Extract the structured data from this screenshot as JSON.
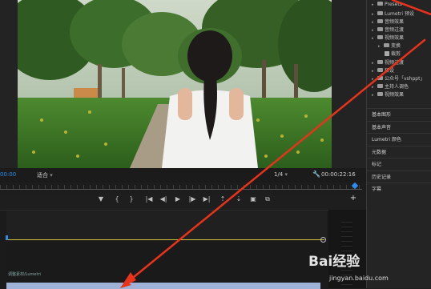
{
  "monitor": {
    "timecode_left": "00:00",
    "fit": "适合",
    "resolution": "1/4",
    "timecode_right": "00:00:22:16"
  },
  "transport": {
    "icons": [
      "marker-icon",
      "in-point-icon",
      "out-point-icon",
      "go-to-in-icon",
      "step-back-icon",
      "play-icon",
      "step-forward-icon",
      "go-to-out-icon",
      "lift-icon",
      "extract-icon",
      "export-frame-icon",
      "compare-icon"
    ],
    "glyphs": [
      "▼",
      "{",
      "}",
      "|◀",
      "◀|",
      "▶",
      "|▶",
      "▶|",
      "⇡",
      "⇣",
      "▣",
      "⧉"
    ],
    "add": "+"
  },
  "timeline": {
    "clip_label": "调整素材/Lumetri"
  },
  "effects_tree": [
    {
      "label": "Presets",
      "kind": "folder"
    },
    {
      "label": "Lumetri 预设",
      "kind": "folder"
    },
    {
      "label": "音频效果",
      "kind": "folder"
    },
    {
      "label": "音频过渡",
      "kind": "folder"
    },
    {
      "label": "视频效果",
      "kind": "folder"
    },
    {
      "label": "变换",
      "kind": "folder"
    },
    {
      "label": "裁剪",
      "kind": "effect"
    },
    {
      "label": "视频过渡",
      "kind": "folder"
    },
    {
      "label": "预设",
      "kind": "folder"
    },
    {
      "label": "公众号「vshppt」",
      "kind": "folder"
    },
    {
      "label": "主持人调色",
      "kind": "folder"
    },
    {
      "label": "视频效果",
      "kind": "folder"
    }
  ],
  "panels": [
    "基本图形",
    "基本声音",
    "Lumetri 颜色",
    "元数据",
    "标记",
    "历史记录",
    "字幕"
  ],
  "watermark": {
    "brand": "Bai经验",
    "url": "jingyan.baidu.com"
  },
  "colors": {
    "accent": "#2d8ceb",
    "annotation": "#e8331c",
    "clip": "#9db2d6"
  }
}
